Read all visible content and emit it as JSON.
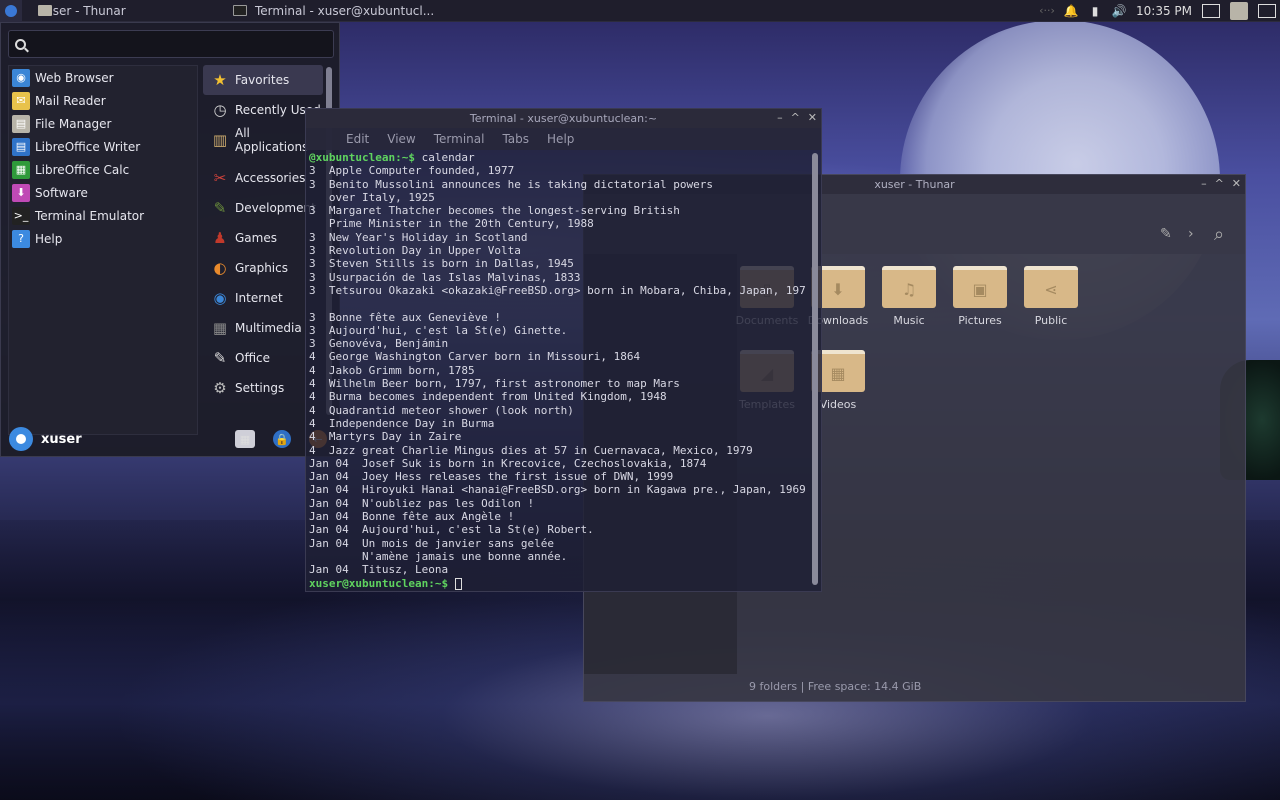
{
  "panel": {
    "tasks": [
      {
        "label": "xuser - Thunar",
        "icon": "folder-icon"
      },
      {
        "label": "Terminal - xuser@xubuntucl...",
        "icon": "terminal-icon"
      }
    ],
    "clock": "10:35 PM"
  },
  "whisker": {
    "search_placeholder": "",
    "favorites": [
      {
        "label": "Web Browser",
        "icon": "globe-icon",
        "color": "#3b86d6"
      },
      {
        "label": "Mail Reader",
        "icon": "mail-icon",
        "color": "#e8c24b"
      },
      {
        "label": "File Manager",
        "icon": "file-manager-icon",
        "color": "#b8b4a8"
      },
      {
        "label": "LibreOffice Writer",
        "icon": "writer-icon",
        "color": "#2f73c8"
      },
      {
        "label": "LibreOffice Calc",
        "icon": "calc-icon",
        "color": "#2f9a3a"
      },
      {
        "label": "Software",
        "icon": "software-icon",
        "color": "#c04ab5"
      },
      {
        "label": "Terminal Emulator",
        "icon": "terminal-icon",
        "color": "#222"
      },
      {
        "label": "Help",
        "icon": "help-icon",
        "color": "#3c8ae0"
      }
    ],
    "categories": [
      {
        "label": "Favorites",
        "icon": "star-icon",
        "color": "#f3c131"
      },
      {
        "label": "Recently Used",
        "icon": "clock-icon",
        "color": "#d4d4d4"
      },
      {
        "label": "All Applications",
        "icon": "apps-icon",
        "color": "#caa96d"
      },
      {
        "label": "Accessories",
        "icon": "accessories-icon",
        "color": "#d2433b"
      },
      {
        "label": "Development",
        "icon": "development-icon",
        "color": "#6b8f3c"
      },
      {
        "label": "Games",
        "icon": "games-icon",
        "color": "#c0392b"
      },
      {
        "label": "Graphics",
        "icon": "graphics-icon",
        "color": "#e98a2c"
      },
      {
        "label": "Internet",
        "icon": "internet-icon",
        "color": "#3b86d6"
      },
      {
        "label": "Multimedia",
        "icon": "multimedia-icon",
        "color": "#888"
      },
      {
        "label": "Office",
        "icon": "office-icon",
        "color": "#ddd"
      },
      {
        "label": "Settings",
        "icon": "settings-icon",
        "color": "#bbb"
      }
    ],
    "username": "xuser"
  },
  "terminal": {
    "title": "Terminal - xuser@xubuntuclean:~",
    "menu": [
      "Edit",
      "View",
      "Terminal",
      "Tabs",
      "Help"
    ],
    "command_prompt": "@xubuntuclean:~$",
    "command": " calendar",
    "lines": [
      "3  Apple Computer founded, 1977",
      "3  Benito Mussolini announces he is taking dictatorial powers",
      "   over Italy, 1925",
      "3  Margaret Thatcher becomes the longest-serving British",
      "   Prime Minister in the 20th Century, 1988",
      "3  New Year's Holiday in Scotland",
      "3  Revolution Day in Upper Volta",
      "3  Steven Stills is born in Dallas, 1945",
      "3  Usurpación de las Islas Malvinas, 1833",
      "3  Tetsurou Okazaki <okazaki@FreeBSD.org> born in Mobara, Chiba, Japan, 197",
      "",
      "3  Bonne fête aux Geneviève !",
      "3  Aujourd'hui, c'est la St(e) Ginette.",
      "3  Genovéva, Benjámin",
      "4  George Washington Carver born in Missouri, 1864",
      "4  Jakob Grimm born, 1785",
      "4  Wilhelm Beer born, 1797, first astronomer to map Mars",
      "4  Burma becomes independent from United Kingdom, 1948",
      "4  Quadrantid meteor shower (look north)",
      "4  Independence Day in Burma",
      "4  Martyrs Day in Zaire",
      "4  Jazz great Charlie Mingus dies at 57 in Cuernavaca, Mexico, 1979",
      "Jan 04  Josef Suk is born in Krecovice, Czechoslovakia, 1874",
      "Jan 04  Joey Hess releases the first issue of DWN, 1999",
      "Jan 04  Hiroyuki Hanai <hanai@FreeBSD.org> born in Kagawa pre., Japan, 1969",
      "Jan 04  N'oubliez pas les Odilon !",
      "Jan 04  Bonne fête aux Angèle !",
      "Jan 04  Aujourd'hui, c'est la St(e) Robert.",
      "Jan 04  Un mois de janvier sans gelée",
      "        N'amène jamais une bonne année.",
      "Jan 04  Titusz, Leona"
    ],
    "final_prompt": "xuser@xubuntuclean:~$"
  },
  "thunar": {
    "title": "xuser - Thunar",
    "folders": [
      {
        "label": "Documents",
        "icon": "document-icon"
      },
      {
        "label": "Downloads",
        "icon": "download-icon"
      },
      {
        "label": "Music",
        "icon": "music-icon"
      },
      {
        "label": "Pictures",
        "icon": "picture-icon"
      },
      {
        "label": "Public",
        "icon": "share-icon"
      },
      {
        "label": "Templates",
        "icon": "template-icon"
      },
      {
        "label": "Videos",
        "icon": "video-icon"
      }
    ],
    "status": "9 folders | Free space: 14.4 GiB"
  }
}
